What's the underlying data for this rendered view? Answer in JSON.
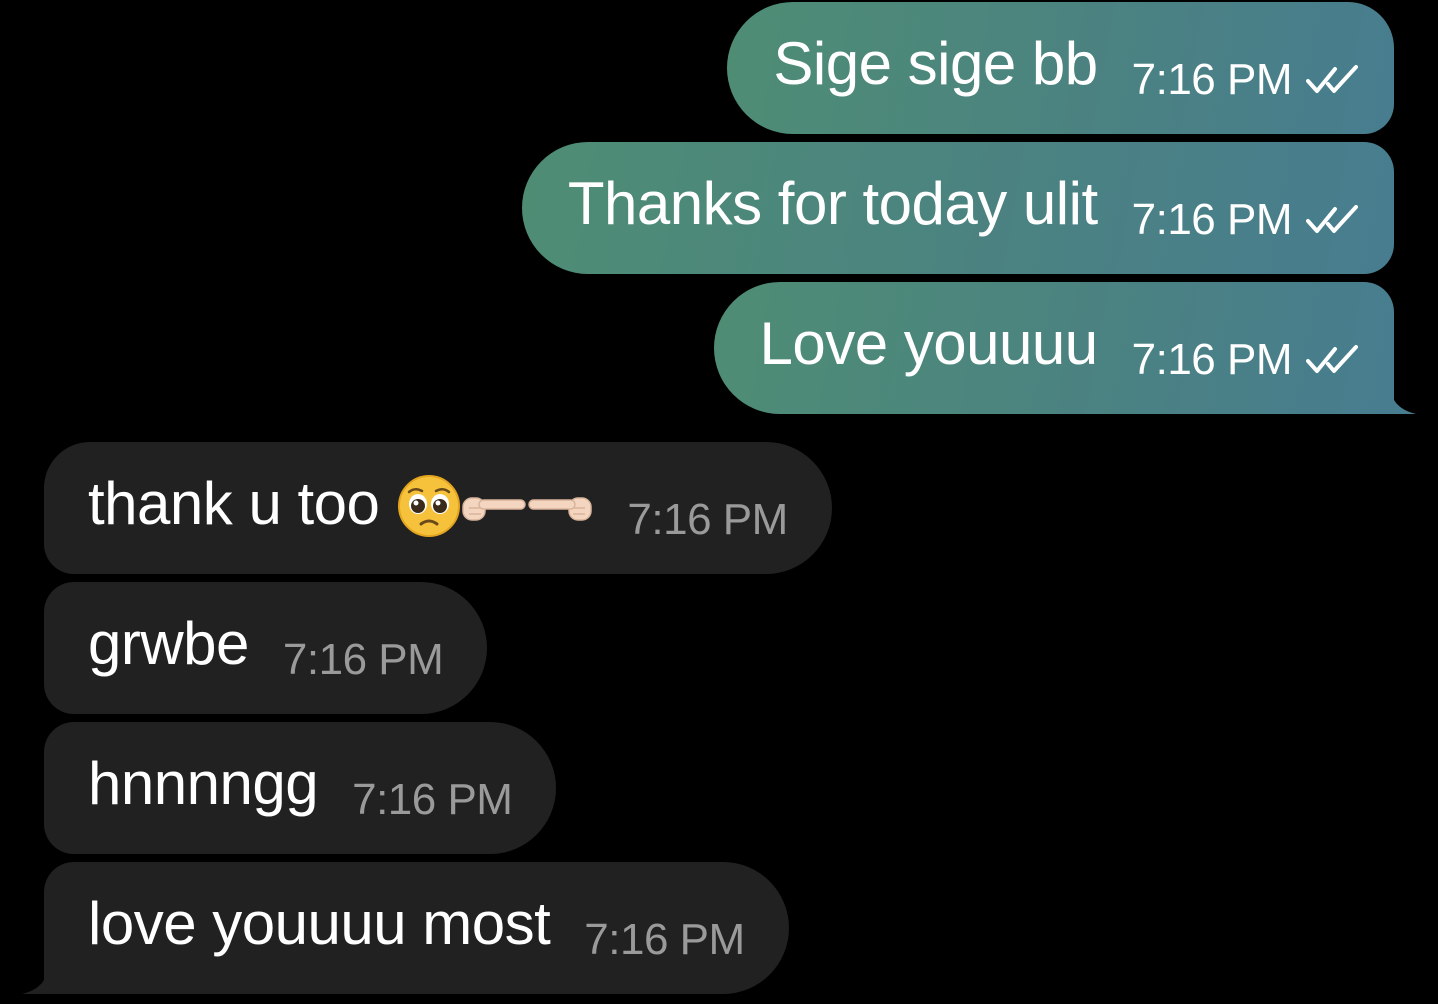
{
  "messages": [
    {
      "direction": "outgoing",
      "text": "Sige sige bb",
      "time": "7:16 PM",
      "status_icon": "double-check-icon"
    },
    {
      "direction": "outgoing",
      "text": "Thanks for today ulit",
      "time": "7:16 PM",
      "status_icon": "double-check-icon"
    },
    {
      "direction": "outgoing",
      "text": "Love youuuu",
      "time": "7:16 PM",
      "status_icon": "double-check-icon"
    },
    {
      "direction": "incoming",
      "text": "thank u too",
      "emojis": [
        "pleading-face-icon",
        "index-pointing-right-icon",
        "index-pointing-left-icon"
      ],
      "time": "7:16 PM"
    },
    {
      "direction": "incoming",
      "text": "grwbe",
      "time": "7:16 PM"
    },
    {
      "direction": "incoming",
      "text": "hnnnngg",
      "time": "7:16 PM"
    },
    {
      "direction": "incoming",
      "text": "love youuuu most",
      "time": "7:16 PM"
    }
  ],
  "colors": {
    "background": "#000000",
    "outgoing_bubble_start": "#4e8d74",
    "outgoing_bubble_end": "#477d8f",
    "incoming_bubble": "#212121",
    "incoming_time": "#9a9a9a",
    "text": "#ffffff"
  }
}
